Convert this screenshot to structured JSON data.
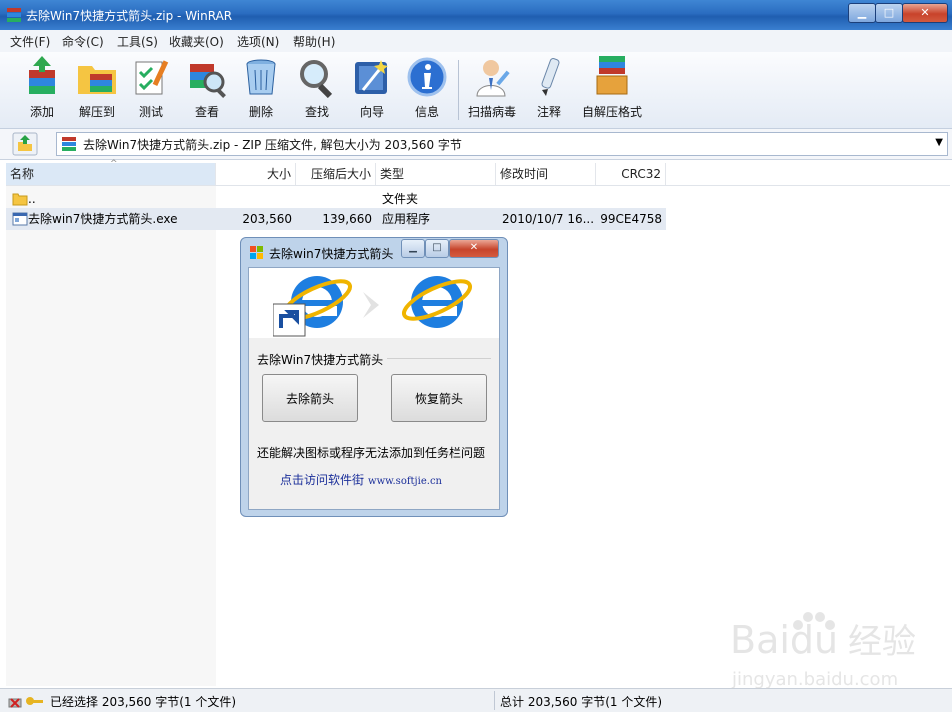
{
  "window": {
    "title": "去除Win7快捷方式箭头.zip - WinRAR"
  },
  "menu": [
    "文件(F)",
    "命令(C)",
    "工具(S)",
    "收藏夹(O)",
    "选项(N)",
    "帮助(H)"
  ],
  "toolbar": [
    {
      "label": "添加",
      "icon": "add-archive-icon"
    },
    {
      "label": "解压到",
      "icon": "extract-to-icon"
    },
    {
      "label": "测试",
      "icon": "test-icon"
    },
    {
      "label": "查看",
      "icon": "view-icon"
    },
    {
      "label": "删除",
      "icon": "delete-icon"
    },
    {
      "label": "查找",
      "icon": "find-icon"
    },
    {
      "label": "向导",
      "icon": "wizard-icon"
    },
    {
      "label": "信息",
      "icon": "info-icon"
    },
    {
      "label": "扫描病毒",
      "icon": "virus-scan-icon"
    },
    {
      "label": "注释",
      "icon": "comment-icon"
    },
    {
      "label": "自解压格式",
      "icon": "sfx-icon"
    }
  ],
  "address": {
    "path": "去除Win7快捷方式箭头.zip - ZIP 压缩文件, 解包大小为 203,560 字节"
  },
  "columns": {
    "name": "名称",
    "size": "大小",
    "packed": "压缩后大小",
    "type": "类型",
    "modified": "修改时间",
    "crc": "CRC32"
  },
  "rows": [
    {
      "name": "..",
      "size": "",
      "packed": "",
      "type": "文件夹",
      "modified": "",
      "crc": ""
    },
    {
      "name": "去除win7快捷方式箭头.exe",
      "size": "203,560",
      "packed": "139,660",
      "type": "应用程序",
      "modified": "2010/10/7 16...",
      "crc": "99CE4758"
    }
  ],
  "dialog": {
    "title": "去除win7快捷方式箭头",
    "group_label": "去除Win7快捷方式箭头",
    "remove_button": "去除箭头",
    "restore_button": "恢复箭头",
    "note": "还能解决图标或程序无法添加到任务栏问题",
    "link_text": "点击访问软件街",
    "link_url": "www.softjie.cn"
  },
  "status": {
    "left": "已经选择 203,560 字节(1 个文件)",
    "right": "总计 203,560 字节(1 个文件)"
  },
  "watermark": {
    "brand": "Baidu",
    "brand2": "经验",
    "url": "jingyan.baidu.com"
  },
  "colors": {
    "titlebar": "#2a6cc0",
    "selection": "#dbe8f6",
    "link": "#1b2f9a",
    "ie_blue": "#1e7ee0",
    "ie_ring": "#f0b400"
  }
}
